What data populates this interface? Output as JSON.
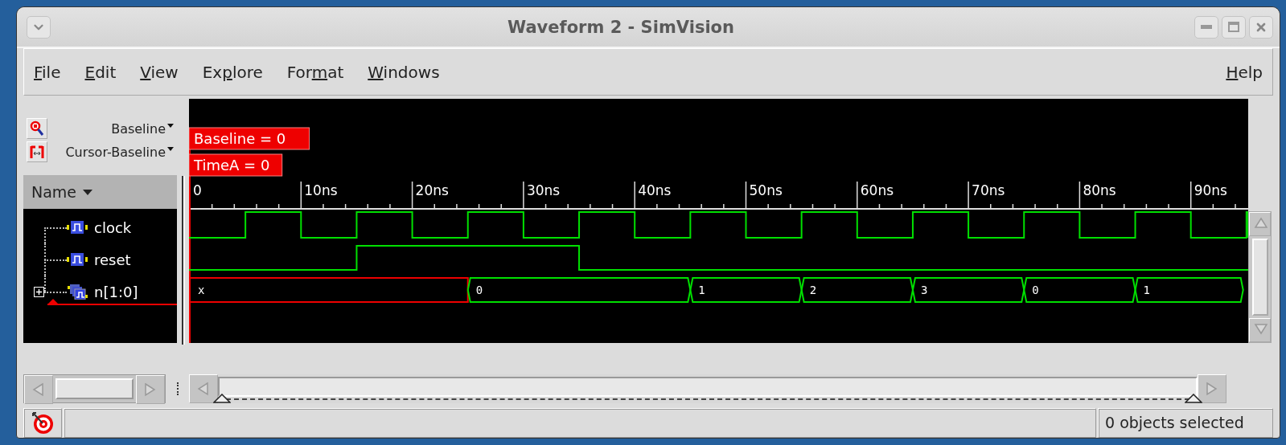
{
  "window": {
    "title": "Waveform 2 - SimVision"
  },
  "menu": [
    {
      "parts": [
        {
          "text": "F",
          "underline": true
        },
        {
          "text": "ile",
          "underline": false
        }
      ]
    },
    {
      "parts": [
        {
          "text": "E",
          "underline": true
        },
        {
          "text": "dit",
          "underline": false
        }
      ]
    },
    {
      "parts": [
        {
          "text": "V",
          "underline": true
        },
        {
          "text": "iew",
          "underline": false
        }
      ]
    },
    {
      "parts": [
        {
          "text": "Ex",
          "underline": false
        },
        {
          "text": "p",
          "underline": true
        },
        {
          "text": "lore",
          "underline": false
        }
      ]
    },
    {
      "parts": [
        {
          "text": "For",
          "underline": false
        },
        {
          "text": "m",
          "underline": true
        },
        {
          "text": "at",
          "underline": false
        }
      ]
    },
    {
      "parts": [
        {
          "text": "W",
          "underline": true
        },
        {
          "text": "indows",
          "underline": false
        }
      ]
    }
  ],
  "help_menu": {
    "parts": [
      {
        "text": "H",
        "underline": true
      },
      {
        "text": "elp",
        "underline": false
      }
    ]
  },
  "cursor_controls": [
    {
      "label": "Baseline",
      "kind": "zoom"
    },
    {
      "label": "Cursor-Baseline",
      "kind": "delta"
    }
  ],
  "name_column": {
    "label": "Name"
  },
  "signals": [
    {
      "name": "clock",
      "kind": "clock"
    },
    {
      "name": "reset",
      "kind": "step"
    },
    {
      "name": "n[1:0]",
      "kind": "bus",
      "expanded": false,
      "values": [
        {
          "value": "x",
          "known": false
        },
        {
          "value": "0",
          "known": true
        },
        {
          "value": "1",
          "known": true
        },
        {
          "value": "2",
          "known": true
        },
        {
          "value": "3",
          "known": true
        },
        {
          "value": "0",
          "known": true
        },
        {
          "value": "1",
          "known": true
        }
      ]
    }
  ],
  "markers": [
    {
      "label": "Baseline = 0"
    },
    {
      "label": "TimeA = 0"
    }
  ],
  "time_ruler": [
    "0",
    "10ns",
    "20ns",
    "30ns",
    "40ns",
    "50ns",
    "60ns",
    "70ns",
    "80ns",
    "90ns"
  ],
  "status_bar": {
    "selection": "0 objects selected"
  }
}
